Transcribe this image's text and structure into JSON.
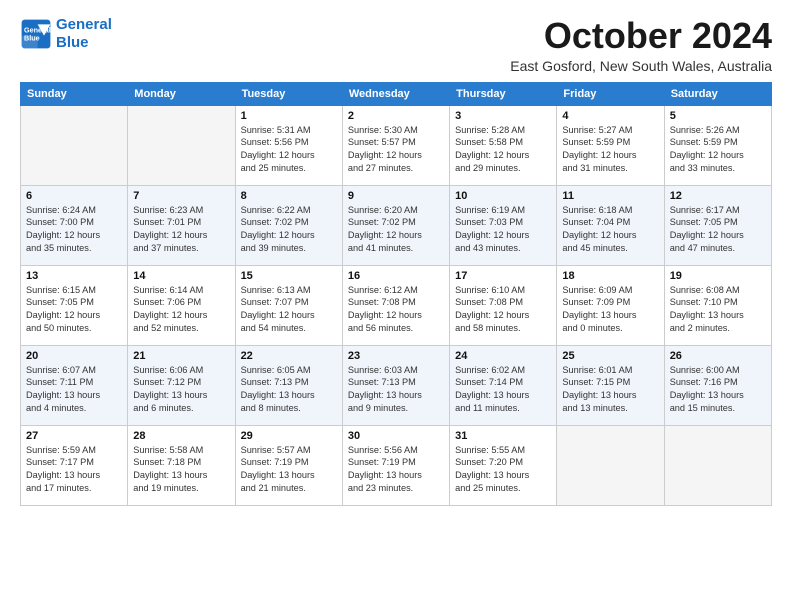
{
  "header": {
    "logo_line1": "General",
    "logo_line2": "Blue",
    "month": "October 2024",
    "location": "East Gosford, New South Wales, Australia"
  },
  "days_of_week": [
    "Sunday",
    "Monday",
    "Tuesday",
    "Wednesday",
    "Thursday",
    "Friday",
    "Saturday"
  ],
  "weeks": [
    [
      {
        "num": "",
        "detail": "",
        "empty": true
      },
      {
        "num": "",
        "detail": "",
        "empty": true
      },
      {
        "num": "1",
        "detail": "Sunrise: 5:31 AM\nSunset: 5:56 PM\nDaylight: 12 hours\nand 25 minutes."
      },
      {
        "num": "2",
        "detail": "Sunrise: 5:30 AM\nSunset: 5:57 PM\nDaylight: 12 hours\nand 27 minutes."
      },
      {
        "num": "3",
        "detail": "Sunrise: 5:28 AM\nSunset: 5:58 PM\nDaylight: 12 hours\nand 29 minutes."
      },
      {
        "num": "4",
        "detail": "Sunrise: 5:27 AM\nSunset: 5:59 PM\nDaylight: 12 hours\nand 31 minutes."
      },
      {
        "num": "5",
        "detail": "Sunrise: 5:26 AM\nSunset: 5:59 PM\nDaylight: 12 hours\nand 33 minutes."
      }
    ],
    [
      {
        "num": "6",
        "detail": "Sunrise: 6:24 AM\nSunset: 7:00 PM\nDaylight: 12 hours\nand 35 minutes."
      },
      {
        "num": "7",
        "detail": "Sunrise: 6:23 AM\nSunset: 7:01 PM\nDaylight: 12 hours\nand 37 minutes."
      },
      {
        "num": "8",
        "detail": "Sunrise: 6:22 AM\nSunset: 7:02 PM\nDaylight: 12 hours\nand 39 minutes."
      },
      {
        "num": "9",
        "detail": "Sunrise: 6:20 AM\nSunset: 7:02 PM\nDaylight: 12 hours\nand 41 minutes."
      },
      {
        "num": "10",
        "detail": "Sunrise: 6:19 AM\nSunset: 7:03 PM\nDaylight: 12 hours\nand 43 minutes."
      },
      {
        "num": "11",
        "detail": "Sunrise: 6:18 AM\nSunset: 7:04 PM\nDaylight: 12 hours\nand 45 minutes."
      },
      {
        "num": "12",
        "detail": "Sunrise: 6:17 AM\nSunset: 7:05 PM\nDaylight: 12 hours\nand 47 minutes."
      }
    ],
    [
      {
        "num": "13",
        "detail": "Sunrise: 6:15 AM\nSunset: 7:05 PM\nDaylight: 12 hours\nand 50 minutes."
      },
      {
        "num": "14",
        "detail": "Sunrise: 6:14 AM\nSunset: 7:06 PM\nDaylight: 12 hours\nand 52 minutes."
      },
      {
        "num": "15",
        "detail": "Sunrise: 6:13 AM\nSunset: 7:07 PM\nDaylight: 12 hours\nand 54 minutes."
      },
      {
        "num": "16",
        "detail": "Sunrise: 6:12 AM\nSunset: 7:08 PM\nDaylight: 12 hours\nand 56 minutes."
      },
      {
        "num": "17",
        "detail": "Sunrise: 6:10 AM\nSunset: 7:08 PM\nDaylight: 12 hours\nand 58 minutes."
      },
      {
        "num": "18",
        "detail": "Sunrise: 6:09 AM\nSunset: 7:09 PM\nDaylight: 13 hours\nand 0 minutes."
      },
      {
        "num": "19",
        "detail": "Sunrise: 6:08 AM\nSunset: 7:10 PM\nDaylight: 13 hours\nand 2 minutes."
      }
    ],
    [
      {
        "num": "20",
        "detail": "Sunrise: 6:07 AM\nSunset: 7:11 PM\nDaylight: 13 hours\nand 4 minutes."
      },
      {
        "num": "21",
        "detail": "Sunrise: 6:06 AM\nSunset: 7:12 PM\nDaylight: 13 hours\nand 6 minutes."
      },
      {
        "num": "22",
        "detail": "Sunrise: 6:05 AM\nSunset: 7:13 PM\nDaylight: 13 hours\nand 8 minutes."
      },
      {
        "num": "23",
        "detail": "Sunrise: 6:03 AM\nSunset: 7:13 PM\nDaylight: 13 hours\nand 9 minutes."
      },
      {
        "num": "24",
        "detail": "Sunrise: 6:02 AM\nSunset: 7:14 PM\nDaylight: 13 hours\nand 11 minutes."
      },
      {
        "num": "25",
        "detail": "Sunrise: 6:01 AM\nSunset: 7:15 PM\nDaylight: 13 hours\nand 13 minutes."
      },
      {
        "num": "26",
        "detail": "Sunrise: 6:00 AM\nSunset: 7:16 PM\nDaylight: 13 hours\nand 15 minutes."
      }
    ],
    [
      {
        "num": "27",
        "detail": "Sunrise: 5:59 AM\nSunset: 7:17 PM\nDaylight: 13 hours\nand 17 minutes."
      },
      {
        "num": "28",
        "detail": "Sunrise: 5:58 AM\nSunset: 7:18 PM\nDaylight: 13 hours\nand 19 minutes."
      },
      {
        "num": "29",
        "detail": "Sunrise: 5:57 AM\nSunset: 7:19 PM\nDaylight: 13 hours\nand 21 minutes."
      },
      {
        "num": "30",
        "detail": "Sunrise: 5:56 AM\nSunset: 7:19 PM\nDaylight: 13 hours\nand 23 minutes."
      },
      {
        "num": "31",
        "detail": "Sunrise: 5:55 AM\nSunset: 7:20 PM\nDaylight: 13 hours\nand 25 minutes."
      },
      {
        "num": "",
        "detail": "",
        "empty": true
      },
      {
        "num": "",
        "detail": "",
        "empty": true
      }
    ]
  ]
}
